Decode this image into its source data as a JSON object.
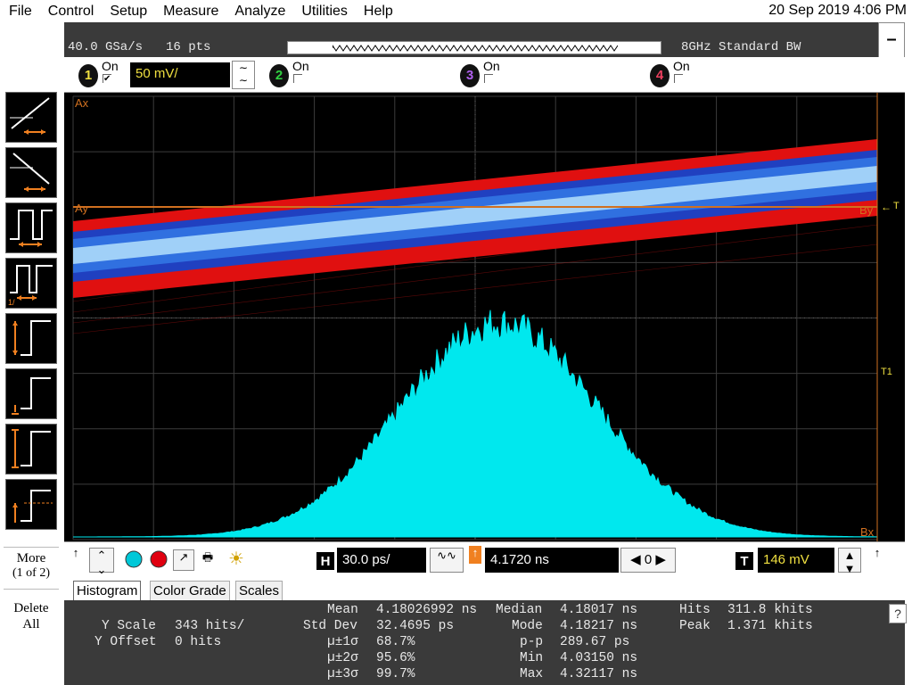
{
  "menu": [
    "File",
    "Control",
    "Setup",
    "Measure",
    "Analyze",
    "Utilities",
    "Help"
  ],
  "clock": "20 Sep 2019  4:06 PM",
  "acquisition": {
    "sample_rate": "40.0 GSa/s",
    "points": "16 pts",
    "bandwidth": "8GHz Standard BW"
  },
  "channels": [
    {
      "num": "1",
      "on_label": "On",
      "checked": "✔",
      "scale": "50 mV/",
      "color": "#f0e040"
    },
    {
      "num": "2",
      "on_label": "On",
      "checked": "",
      "color": "#30d040"
    },
    {
      "num": "3",
      "on_label": "On",
      "checked": "",
      "color": "#b060f0"
    },
    {
      "num": "4",
      "on_label": "On",
      "checked": "",
      "color": "#f04060"
    }
  ],
  "screen": {
    "markers": {
      "ax": "Ax",
      "ay": "Ay",
      "by": "By",
      "bx": "Bx",
      "trig": "T",
      "trig2": "T1"
    },
    "colors": {
      "grid": "#3c3c3c",
      "cursor": "#d07020",
      "hist": "#00e8ee",
      "band_outer": "#e01010",
      "band_mid": "#2040c0",
      "band_inner": "#a0d0f8"
    }
  },
  "controls": {
    "horiz_label": "H",
    "horiz_scale": "30.0 ps/",
    "horiz_pos": "4.1720 ns",
    "delay_center": "0",
    "trig_label": "T",
    "trig_level": "146 mV"
  },
  "left_toolbar": {
    "more_l1": "More",
    "more_l2": "(1 of 2)",
    "delete_l1": "Delete",
    "delete_l2": "All"
  },
  "tabs": [
    "Histogram",
    "Color Grade",
    "Scales"
  ],
  "results": {
    "y_scale_label": "Y Scale",
    "y_scale": "343 hits/",
    "y_offset_label": "Y Offset",
    "y_offset": "0 hits",
    "mean_label": "Mean",
    "mean": "4.18026992 ns",
    "std_label": "Std Dev",
    "std": "32.4695 ps",
    "s1_label": "µ±1σ",
    "s1": "68.7%",
    "s2_label": "µ±2σ",
    "s2": "95.6%",
    "s3_label": "µ±3σ",
    "s3": "99.7%",
    "median_label": "Median",
    "median": "4.18017 ns",
    "mode_label": "Mode",
    "mode": "4.18217 ns",
    "pp_label": "p-p",
    "pp": "289.67 ps",
    "min_label": "Min",
    "min": "4.03150 ns",
    "max_label": "Max",
    "max": "4.32117 ns",
    "hits_label": "Hits",
    "hits": "311.8 khits",
    "peak_label": "Peak",
    "peak": "1.371 khits",
    "help": "?"
  },
  "minimize": "–"
}
